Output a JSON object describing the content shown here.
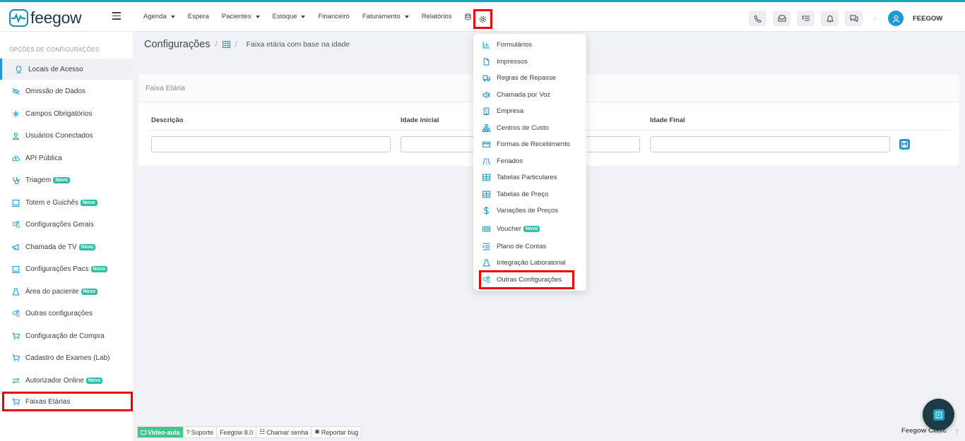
{
  "app": {
    "logo_text": "feegow",
    "user_name": "FEEGOW"
  },
  "nav": [
    {
      "label": "Agenda",
      "caret": true
    },
    {
      "label": "Espera",
      "caret": false
    },
    {
      "label": "Pacientes",
      "caret": true
    },
    {
      "label": "Estoque",
      "caret": true
    },
    {
      "label": "Financeiro",
      "caret": false
    },
    {
      "label": "Faturamento",
      "caret": true
    },
    {
      "label": "Relatórios",
      "caret": false
    }
  ],
  "sidebar": {
    "title": "OPÇÕES DE CONFIGURAÇÕES",
    "items": [
      {
        "label": "Locais de Acesso",
        "icon": "location-icon",
        "badge": ""
      },
      {
        "label": "Omissão de Dados",
        "icon": "eye-off-icon",
        "badge": ""
      },
      {
        "label": "Campos Obrigatórios",
        "icon": "asterisk-icon",
        "badge": ""
      },
      {
        "label": "Usuários Conectados",
        "icon": "user-icon",
        "badge": ""
      },
      {
        "label": "API Pública",
        "icon": "cloud-icon",
        "badge": ""
      },
      {
        "label": "Triagem",
        "icon": "stethoscope-icon",
        "badge": "Novo"
      },
      {
        "label": "Totem e Guichês",
        "icon": "monitor-icon",
        "badge": "Novo"
      },
      {
        "label": "Configurações Gerais",
        "icon": "gears-icon",
        "badge": ""
      },
      {
        "label": "Chamada de TV",
        "icon": "megaphone-icon",
        "badge": "Novo"
      },
      {
        "label": "Configurações Pacs",
        "icon": "monitor-icon",
        "badge": "Novo"
      },
      {
        "label": "Área do paciente",
        "icon": "flask-icon",
        "badge": "Novo"
      },
      {
        "label": "Outras configurações",
        "icon": "gears-icon",
        "badge": ""
      },
      {
        "label": "Configuração de Compra",
        "icon": "cart-icon",
        "badge": ""
      },
      {
        "label": "Cadastro de Exames (Lab)",
        "icon": "cart-icon",
        "badge": ""
      },
      {
        "label": "Autorizador Online",
        "icon": "arrows-icon",
        "badge": "Novo"
      },
      {
        "label": "Faixas Etárias",
        "icon": "cart-icon",
        "badge": ""
      }
    ]
  },
  "breadcrumb": {
    "title": "Configurações",
    "current": "Faixa etária com base na idade"
  },
  "panel": {
    "title": "Faixa Etária",
    "columns": [
      "Descrição",
      "Idade inicial",
      "Idade Final"
    ]
  },
  "dropdown": {
    "items": [
      {
        "label": "Formulários",
        "icon": "chart-icon",
        "badge": ""
      },
      {
        "label": "Impressos",
        "icon": "file-icon",
        "badge": ""
      },
      {
        "label": "Regras de Repasse",
        "icon": "truck-icon",
        "badge": ""
      },
      {
        "label": "Chamada por Voz",
        "icon": "speaker-icon",
        "badge": ""
      },
      {
        "label": "Empresa",
        "icon": "building-icon",
        "badge": ""
      },
      {
        "label": "Centros de Custo",
        "icon": "sitemap-icon",
        "badge": ""
      },
      {
        "label": "Formas de Recebimento",
        "icon": "credit-card-icon",
        "badge": ""
      },
      {
        "label": "Feriados",
        "icon": "road-icon",
        "badge": ""
      },
      {
        "label": "Tabelas Particulares",
        "icon": "table-icon",
        "badge": ""
      },
      {
        "label": "Tabelas de Preço",
        "icon": "table-icon",
        "badge": ""
      },
      {
        "label": "Variações de Preços",
        "icon": "dollar-icon",
        "badge": ""
      },
      {
        "label": "Voucher",
        "icon": "ticket-icon",
        "badge": "Novo"
      },
      {
        "label": "Plano de Contas",
        "icon": "list-indent-icon",
        "badge": ""
      },
      {
        "label": "Integração Laboratorial",
        "icon": "flask-icon",
        "badge": ""
      },
      {
        "label": "Outras Configurações",
        "icon": "gears-icon",
        "badge": ""
      }
    ]
  },
  "footer": {
    "video": "Vídeo-aula",
    "support": "Suporte",
    "version": "Feegow 8.0",
    "call": "Chamar senha",
    "bug": "Reportar bug",
    "brand": "Feegow Clinic"
  },
  "colors": {
    "accent": "#1a9bd7",
    "highlight": "#e00000",
    "badge": "#2ec0a6"
  }
}
